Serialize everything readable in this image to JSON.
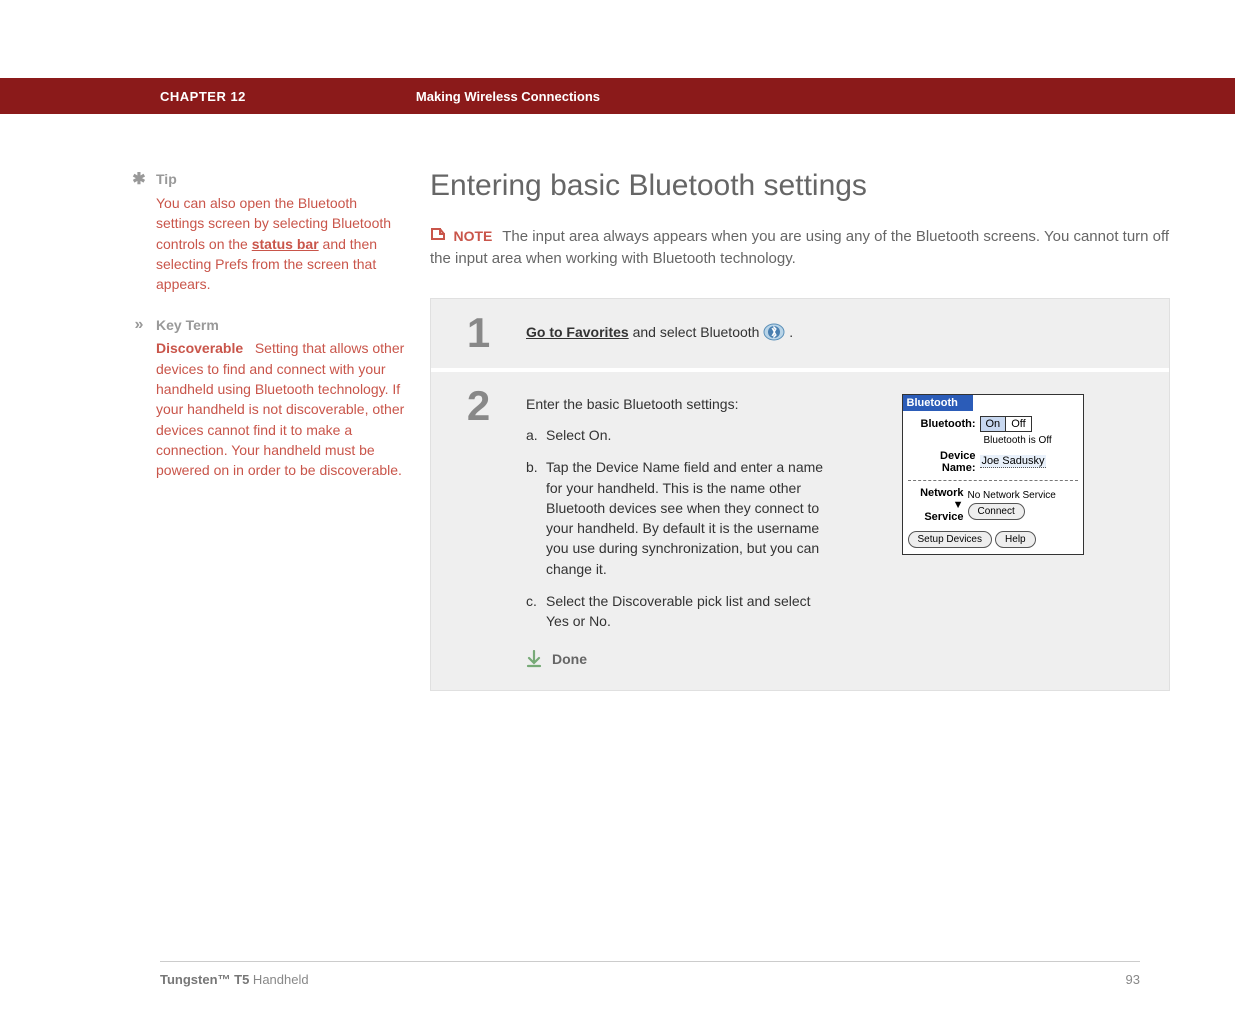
{
  "header": {
    "chapter": "CHAPTER 12",
    "section": "Making Wireless Connections"
  },
  "sidebar": {
    "tip": {
      "label": "Tip",
      "text_before": "You can also open the Bluetooth settings screen by selecting Bluetooth controls on the ",
      "link": "status bar",
      "text_after": " and then selecting Prefs from the screen that appears."
    },
    "keyterm": {
      "label": "Key Term",
      "word": "Discoverable",
      "definition": "Setting that allows other devices to find and connect with your handheld using Bluetooth technology. If your handheld is not discoverable, other devices cannot find it to make a connection. Your handheld must be powered on in order to be discoverable."
    }
  },
  "content": {
    "title": "Entering basic Bluetooth settings",
    "note": {
      "label": "NOTE",
      "text": "The input area always appears when you are using any of the Bluetooth screens. You cannot turn off the input area when working with Bluetooth technology."
    },
    "step1": {
      "num": "1",
      "link": "Go to Favorites",
      "after": " and select Bluetooth "
    },
    "step2": {
      "num": "2",
      "intro": "Enter the basic Bluetooth settings:",
      "items": {
        "a": "Select On.",
        "b": "Tap the Device Name field and enter a name for your handheld. This is the name other Bluetooth devices see when they connect to your handheld. By default it is the username you use during synchronization, but you can change it.",
        "c": "Select the Discoverable pick list and select Yes or No."
      },
      "done": "Done"
    },
    "palm": {
      "title": "Bluetooth",
      "bt_label": "Bluetooth:",
      "on": "On",
      "off": "Off",
      "status": "Bluetooth is Off",
      "devname_label": "Device Name:",
      "devname_value": "Joe Sadusky",
      "net_label1": "Network",
      "net_label2": "Service",
      "net_value": "No Network Service",
      "connect": "Connect",
      "setup": "Setup Devices",
      "help": "Help"
    }
  },
  "footer": {
    "product_bold": "Tungsten™ T5",
    "product_light": " Handheld",
    "page": "93"
  }
}
